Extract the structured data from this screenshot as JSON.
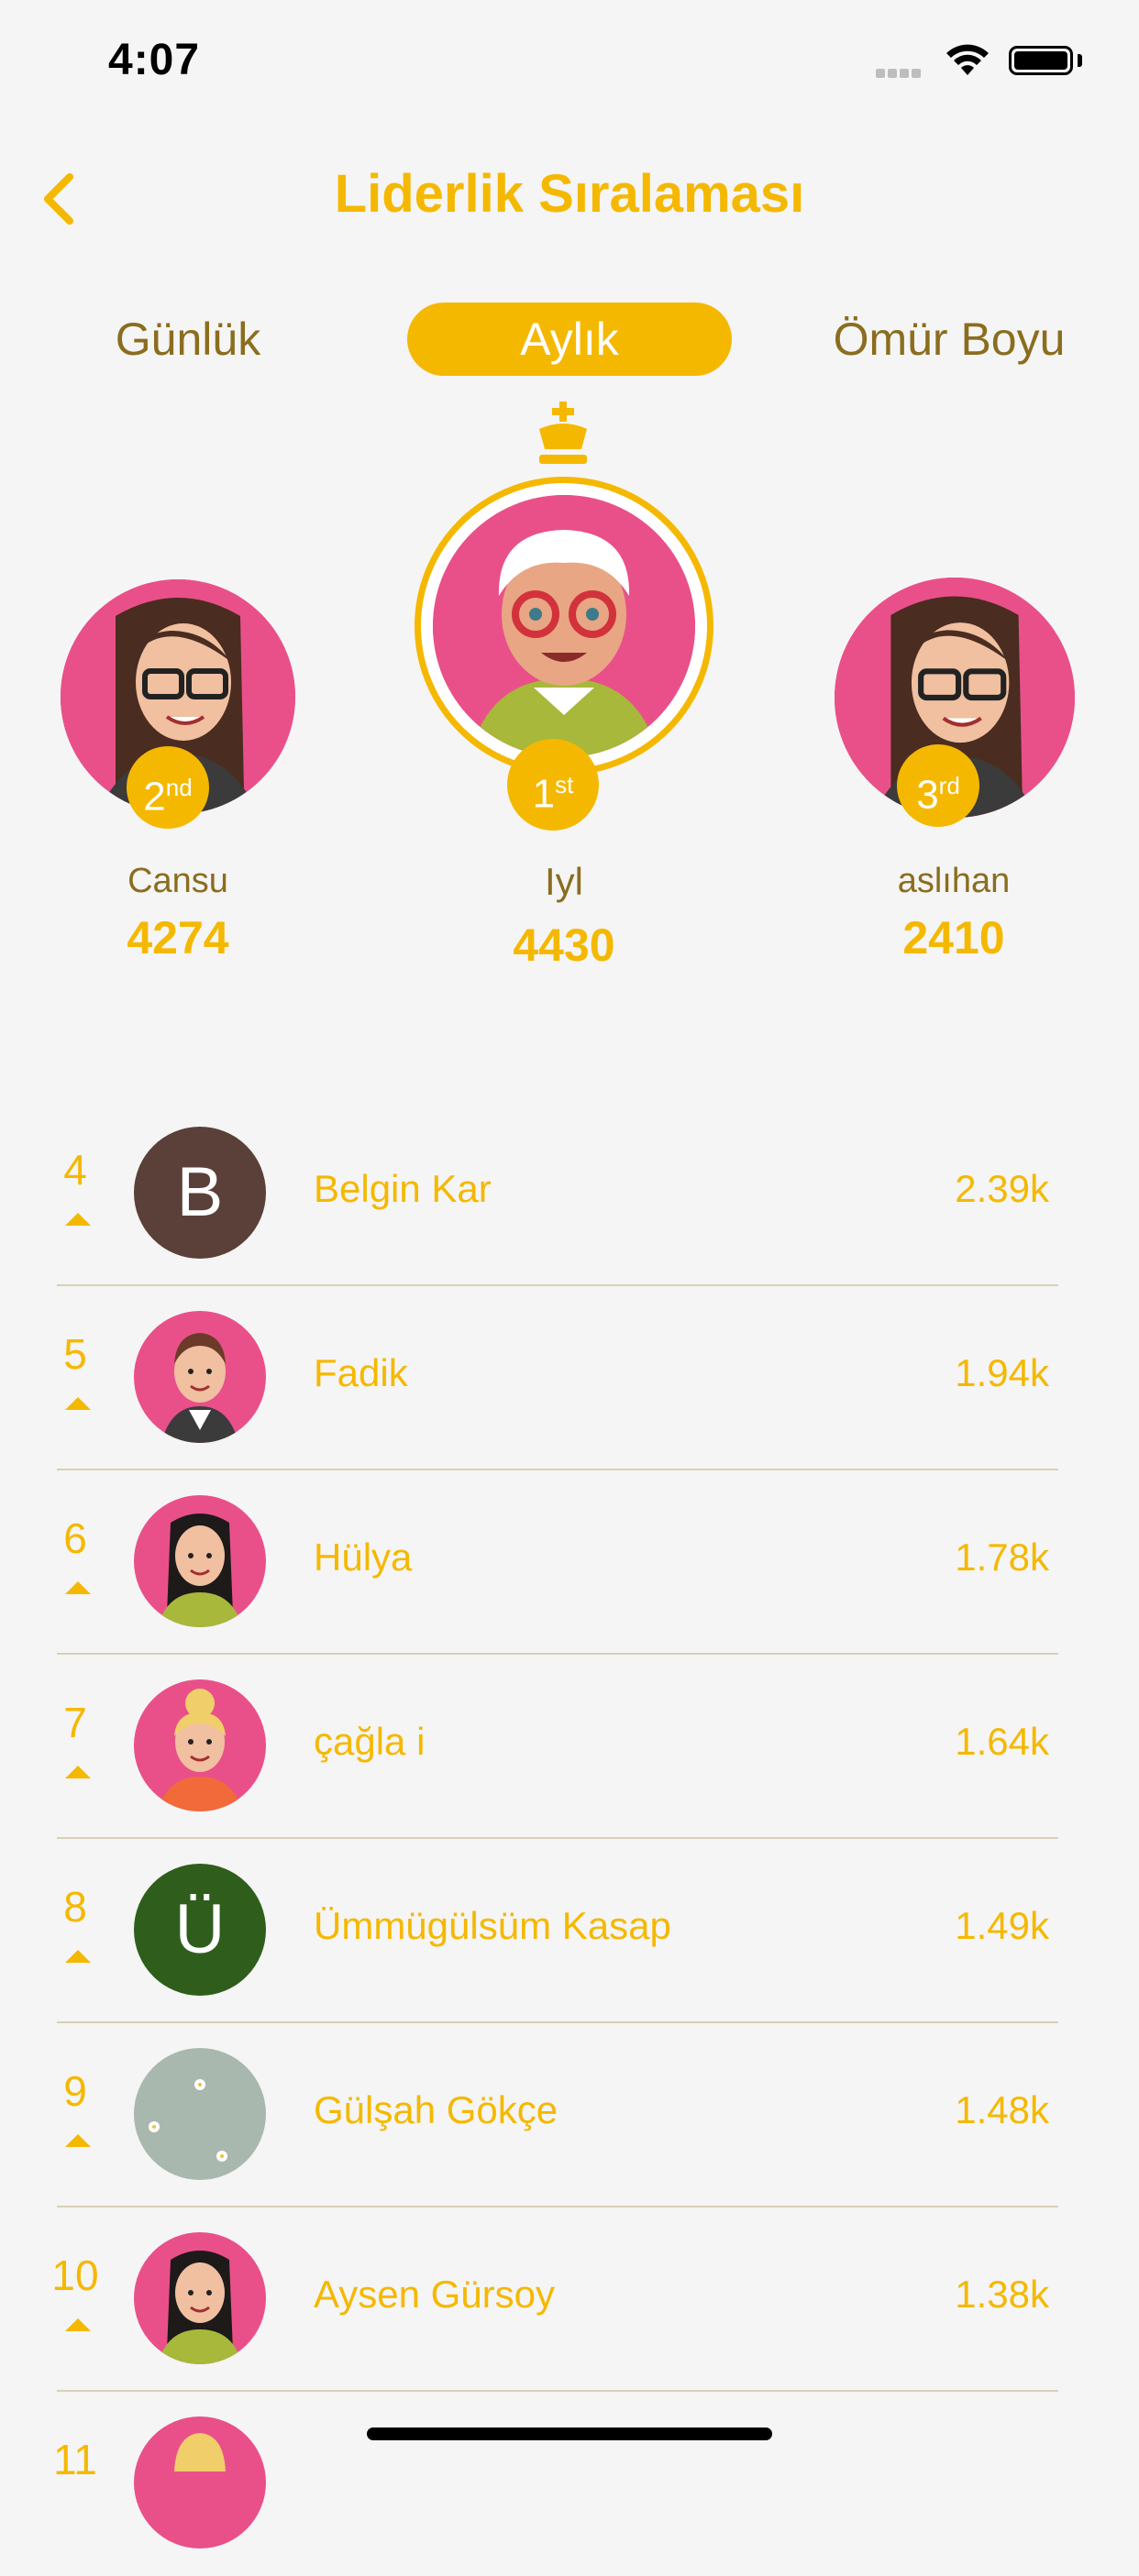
{
  "status_bar": {
    "time": "4:07"
  },
  "header": {
    "title": "Liderlik Sıralaması",
    "back_icon": "chevron-left-icon"
  },
  "tabs": [
    {
      "label": "Günlük",
      "active": false
    },
    {
      "label": "Aylık",
      "active": true
    },
    {
      "label": "Ömür Boyu",
      "active": false
    }
  ],
  "podium": {
    "first": {
      "rank": "1",
      "suffix": "st",
      "name": "Iyl",
      "score": "4430"
    },
    "second": {
      "rank": "2",
      "suffix": "nd",
      "name": "Cansu",
      "score": "4274"
    },
    "third": {
      "rank": "3",
      "suffix": "rd",
      "name": "aslıhan",
      "score": "2410"
    }
  },
  "list": [
    {
      "rank": "4",
      "name": "Belgin Kar",
      "score": "2.39k",
      "avatar": "letter",
      "letter": "B",
      "color": "#5a4038"
    },
    {
      "rank": "5",
      "name": "Fadik",
      "score": "1.94k",
      "avatar": "image"
    },
    {
      "rank": "6",
      "name": "Hülya",
      "score": "1.78k",
      "avatar": "image"
    },
    {
      "rank": "7",
      "name": "çağla i",
      "score": "1.64k",
      "avatar": "image"
    },
    {
      "rank": "8",
      "name": "Ümmügülsüm Kasap",
      "score": "1.49k",
      "avatar": "letter",
      "letter": "Ü",
      "color": "#2f5e1c"
    },
    {
      "rank": "9",
      "name": "Gülşah Gökçe",
      "score": "1.48k",
      "avatar": "image"
    },
    {
      "rank": "10",
      "name": "Aysen Gürsoy",
      "score": "1.38k",
      "avatar": "image"
    },
    {
      "rank": "11",
      "name": "",
      "score": "",
      "avatar": "image"
    }
  ],
  "colors": {
    "accent": "#f5b800",
    "avatar_bg": "#e9508a",
    "text_brown": "#8a6d1e"
  }
}
